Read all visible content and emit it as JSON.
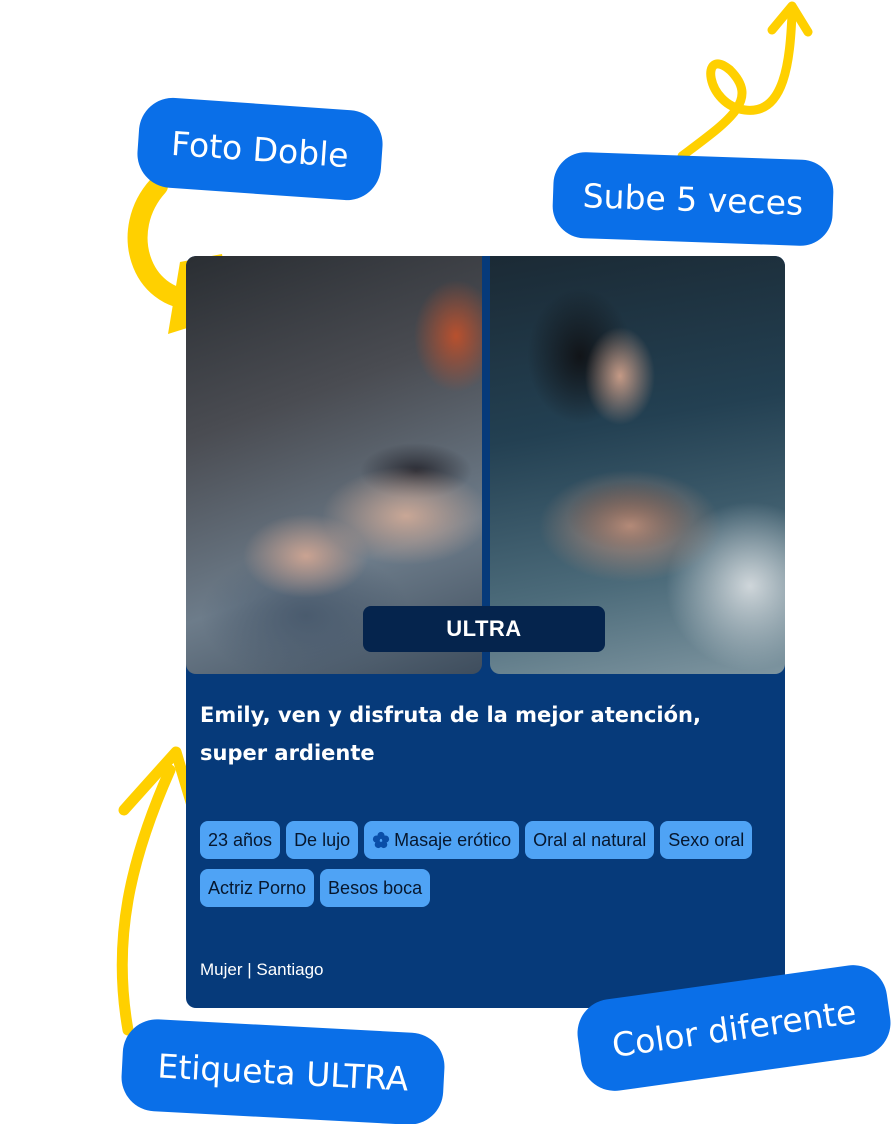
{
  "callouts": {
    "foto_doble": "Foto Doble",
    "sube": "Sube 5 veces",
    "color": "Color diferente",
    "etiqueta": "Etiqueta ULTRA"
  },
  "card": {
    "badge": "ULTRA",
    "title": "Emily, ven y disfruta de la mejor atención, super ardiente",
    "tags": [
      {
        "label": "23 años",
        "icon": ""
      },
      {
        "label": "De lujo",
        "icon": ""
      },
      {
        "label": "Masaje erótico",
        "icon": "flower-icon"
      },
      {
        "label": "Oral al natural",
        "icon": ""
      },
      {
        "label": "Sexo oral",
        "icon": ""
      },
      {
        "label": "Actriz Porno",
        "icon": ""
      },
      {
        "label": "Besos boca",
        "icon": ""
      }
    ],
    "footer": "Mujer | Santiago"
  },
  "colors": {
    "callout_blue": "#0a6fe8",
    "arrow_yellow": "#ffd000",
    "card_bg": "#063a7a",
    "badge_bg": "#05244d",
    "tag_bg": "#4fa3f5"
  }
}
